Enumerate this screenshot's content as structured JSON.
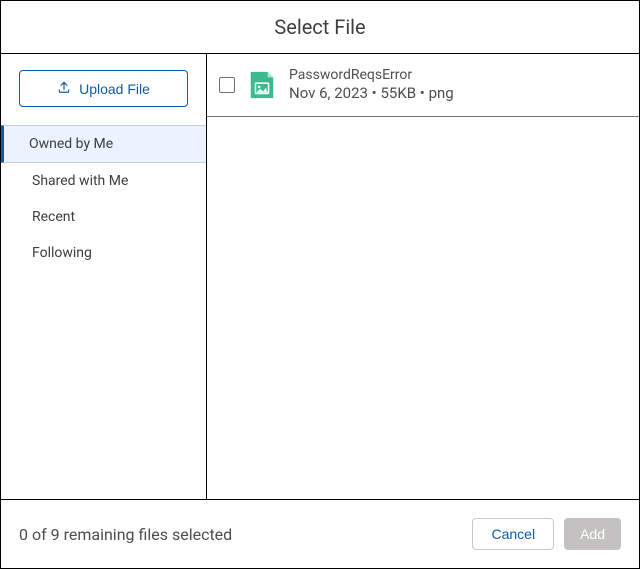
{
  "header": {
    "title": "Select File"
  },
  "sidebar": {
    "upload_label": "Upload File",
    "items": [
      {
        "label": "Owned by Me",
        "active": true
      },
      {
        "label": "Shared with Me",
        "active": false
      },
      {
        "label": "Recent",
        "active": false
      },
      {
        "label": "Following",
        "active": false
      }
    ]
  },
  "files": [
    {
      "name": "PasswordReqsError",
      "date": "Nov 6, 2023",
      "size": "55KB",
      "type": "png",
      "meta": "Nov 6, 2023 • 55KB • png"
    }
  ],
  "footer": {
    "status": "0 of 9 remaining files selected",
    "cancel_label": "Cancel",
    "add_label": "Add"
  },
  "colors": {
    "accent": "#0b5cab",
    "file_icon": "#3bba8d",
    "disabled": "#c4c2c0"
  }
}
